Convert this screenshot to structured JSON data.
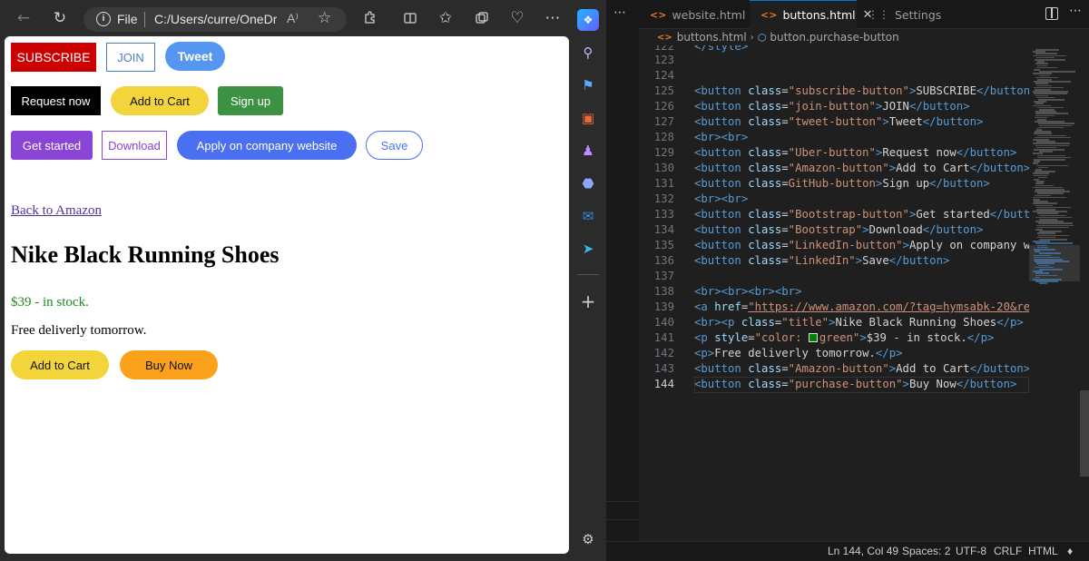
{
  "browser": {
    "address": {
      "scheme_label": "File",
      "path": "C:/Users/curre/OneDri..."
    },
    "page": {
      "buttons_row1": {
        "subscribe": "SUBSCRIBE",
        "join": "JOIN",
        "tweet": "Tweet"
      },
      "buttons_row2": {
        "uber": "Request now",
        "amazon": "Add to Cart",
        "github": "Sign up"
      },
      "buttons_row3": {
        "bootstrap": "Get started",
        "bootstrap_outline": "Download",
        "linkedin": "Apply on company website",
        "linkedin_outline": "Save"
      },
      "back_link": "Back to Amazon",
      "title": "Nike Black Running Shoes",
      "price": "$39 - in stock.",
      "delivery": "Free deliverly tomorrow.",
      "add_to_cart": "Add to Cart",
      "buy_now": "Buy Now"
    }
  },
  "vscode": {
    "tabs": [
      {
        "label": "website.html"
      },
      {
        "label": "buttons.html"
      },
      {
        "label": "Settings"
      }
    ],
    "breadcrumb": {
      "file": "buttons.html",
      "symbol": "button.purchase-button"
    },
    "lines": {
      "l123": "123",
      "l124": "124",
      "l125": "125",
      "l126": "126",
      "l127": "127",
      "l128": "128",
      "l129": "129",
      "l130": "130",
      "l131": "131",
      "l132": "132",
      "l133": "133",
      "l134": "134",
      "l135": "135",
      "l136": "136",
      "l137": "137",
      "l138": "138",
      "l139": "139",
      "l140": "140",
      "l141": "141",
      "l142": "142",
      "l143": "143",
      "l144": "144"
    },
    "status": {
      "position": "Ln 144, Col 49",
      "spaces": "Spaces: 2",
      "encoding": "UTF-8",
      "eol": "CRLF",
      "language": "HTML"
    }
  },
  "colors": {
    "accent": "#0078d4",
    "html_tag": "#569cd6",
    "attr": "#9cdcfe",
    "string": "#ce9178"
  }
}
